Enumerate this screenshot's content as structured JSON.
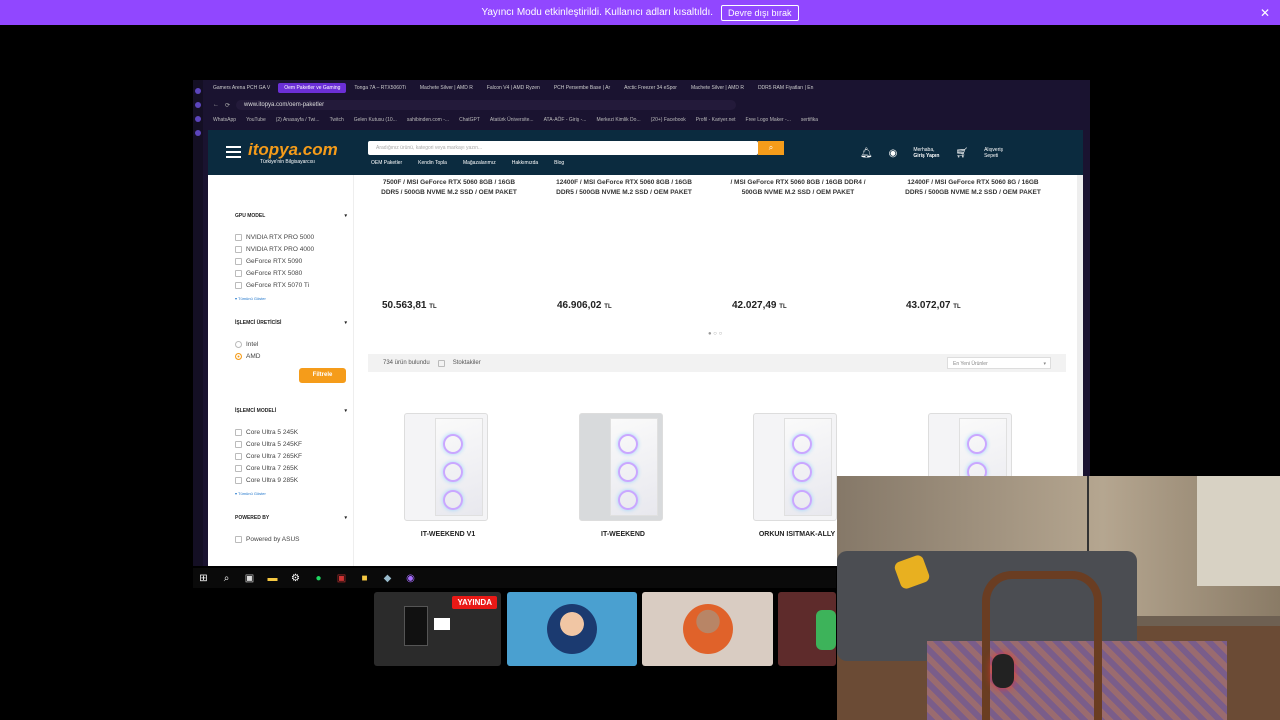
{
  "notification": {
    "message": "Yayıncı Modu etkinleştirildi. Kullanıcı adları kısaltıldı.",
    "button": "Devre dışı bırak",
    "close": "✕"
  },
  "browser": {
    "tabs": [
      {
        "label": "Gamers Arena PCH GA V"
      },
      {
        "label": "Oem Paketler ve Gaming",
        "active": true
      },
      {
        "label": "Tonga 7A – RTX5060Ti"
      },
      {
        "label": "Machete Silver | AMD R"
      },
      {
        "label": "Falcon V4 | AMD Ryzen"
      },
      {
        "label": "PCH Persembe Base | Ar"
      },
      {
        "label": "Arctic Freezer 34 eSpor"
      },
      {
        "label": "Machete Silver | AMD R"
      },
      {
        "label": "DDR5 RAM Fiyatları | En"
      }
    ],
    "url": "www.itopya.com/oem-paketler",
    "bookmarks": [
      "WhatsApp",
      "YouTube",
      "(2) Anasayfa / Twi...",
      "Twitch",
      "Gelen Kutusu (10...",
      "sahibinden.com -...",
      "ChatGPT",
      "Atatürk Üniversite...",
      "ATA-AÖF - Giriş -...",
      "Merkezi Kimlik Do...",
      "(20+) Facebook",
      "Profil - Kariyer.net",
      "Free Logo Maker -...",
      "sertifika"
    ]
  },
  "site": {
    "logo": "itopya.com",
    "logo_sub": "Türkiye'nin Bilgisayarcısı",
    "search_placeholder": "Aradığınız ürünü, kategori veya markayı yazın...",
    "nav": [
      "OEM Paketler",
      "Kendin Topla",
      "Mağazalarımız",
      "Hakkımızda",
      "Blog"
    ],
    "account_greeting": "Merhaba,",
    "account_action": "Giriş Yapın",
    "cart_line1": "Alışveriş",
    "cart_line2": "Sepeti"
  },
  "filters": {
    "gpu_title": "GPU MODEL",
    "gpu_items": [
      "NVIDIA RTX PRO 5000",
      "NVIDIA RTX PRO 4000",
      "GeForce RTX 5090",
      "GeForce RTX 5080",
      "GeForce RTX 5070 Ti"
    ],
    "show_all": "▾ Tümünü Göster",
    "cpu_maker_title": "İŞLEMCİ ÜRETİCİSİ",
    "cpu_makers": [
      {
        "label": "Intel",
        "selected": false
      },
      {
        "label": "AMD",
        "selected": true
      }
    ],
    "filter_button": "Filtrele",
    "cpu_model_title": "İŞLEMCİ MODELİ",
    "cpu_models": [
      "Core Ultra 5 245K",
      "Core Ultra 5 245KF",
      "Core Ultra 7 265KF",
      "Core Ultra 7 265K",
      "Core Ultra 9 285K"
    ],
    "powered_title": "POWERED BY",
    "powered_items": [
      "Powered by ASUS"
    ]
  },
  "featured": [
    {
      "desc": "7500F / MSI GeForce RTX 5060 8GB / 16GB DDR5 / 500GB NVME M.2 SSD / OEM PAKET",
      "price": "50.563,81",
      "currency": "TL"
    },
    {
      "desc": "12400F / MSI GeForce RTX 5060 8GB / 16GB DDR5 / 500GB NVME M.2 SSD / OEM PAKET",
      "price": "46.906,02",
      "currency": "TL"
    },
    {
      "desc": "/ MSI GeForce RTX 5060 8GB / 16GB DDR4 / 500GB NVME M.2 SSD / OEM PAKET",
      "price": "42.027,49",
      "currency": "TL"
    },
    {
      "desc": "12400F / MSI GeForce RTX 5060 8G / 16GB DDR5 / 500GB NVME M.2 SSD / OEM PAKET",
      "price": "43.072,07",
      "currency": "TL"
    }
  ],
  "listing": {
    "count": "734 ürün bulundu",
    "stock_label": "Stoktakiler",
    "sort_value": "En Yeni Ürünler",
    "products": [
      {
        "name": "IT-WEEKEND V1"
      },
      {
        "name": "IT-WEEKEND"
      },
      {
        "name": "ORKUN ISITMAK-ALLY"
      },
      {
        "name": ""
      }
    ]
  },
  "stream": {
    "live_badge": "YAYINDA"
  }
}
